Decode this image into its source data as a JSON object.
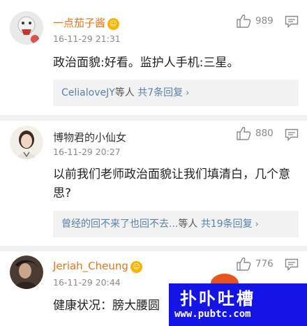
{
  "comments": [
    {
      "name": "一点茄子酱",
      "time": "16-11-29 21:31",
      "likes": "989",
      "text": "政治面貌:好看。监护人手机:三星。",
      "reply": {
        "who": "CelialoveJY",
        "mid": "等人",
        "count": "共7条回复",
        "chevron": "›"
      }
    },
    {
      "name": "博物君的小仙女",
      "time": "16-11-29 20:27",
      "likes": "880",
      "text": "以前我们老师政治面貌让我们填清白，几个意思?",
      "reply": {
        "who": "曾经的回不来了也回不去...",
        "mid": "等人",
        "count": "共19条回复",
        "chevron": "›"
      }
    },
    {
      "name": "Jeriah_Cheung",
      "time": "16-11-29 20:44",
      "likes": "776",
      "text": "健康状况：膀大腰圆"
    }
  ],
  "watermark": {
    "top": "扑卟吐槽",
    "url": "www.pubtc.com"
  },
  "colors": {
    "vip_name": "#e8741a",
    "link": "#5b7fb0",
    "watermark_bg": "#1414e6"
  }
}
